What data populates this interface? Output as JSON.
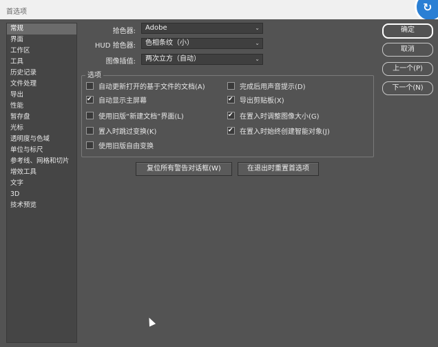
{
  "window": {
    "title": "首选项"
  },
  "sidebar": {
    "items": [
      {
        "label": "常规",
        "selected": true
      },
      {
        "label": "界面"
      },
      {
        "label": "工作区"
      },
      {
        "label": "工具"
      },
      {
        "label": "历史记录"
      },
      {
        "label": "文件处理"
      },
      {
        "label": "导出"
      },
      {
        "label": "性能"
      },
      {
        "label": "暂存盘"
      },
      {
        "label": "光标"
      },
      {
        "label": "透明度与色域"
      },
      {
        "label": "单位与标尺"
      },
      {
        "label": "参考线、网格和切片"
      },
      {
        "label": "增效工具"
      },
      {
        "label": "文字"
      },
      {
        "label": "3D"
      },
      {
        "label": "技术预览"
      }
    ]
  },
  "fields": {
    "color_picker": {
      "label": "拾色器:",
      "value": "Adobe"
    },
    "hud_color_picker": {
      "label": "HUD 拾色器:",
      "value": "色相条纹（小）"
    },
    "image_interpolation": {
      "label": "图像插值:",
      "value": "两次立方（自动）"
    }
  },
  "options": {
    "title": "选项",
    "left": [
      {
        "label": "自动更新打开的基于文件的文档(A)",
        "checked": false
      },
      {
        "label": "自动显示主屏幕",
        "checked": true
      },
      {
        "label": "使用旧版“新建文档”界面(L)",
        "checked": false
      },
      {
        "label": "置入时跳过变换(K)",
        "checked": false
      },
      {
        "label": "使用旧版自由变换",
        "checked": false
      }
    ],
    "right": [
      {
        "label": "完成后用声音提示(D)",
        "checked": false
      },
      {
        "label": "导出剪贴板(X)",
        "checked": true
      },
      {
        "label": "在置入时调整图像大小(G)",
        "checked": true
      },
      {
        "label": "在置入时始终创建智能对象(J)",
        "checked": true
      }
    ]
  },
  "buttons": {
    "reset_warnings": "复位所有警告对话框(W)",
    "reset_on_quit": "在退出时重置首选项",
    "ok": "确定",
    "cancel": "取消",
    "prev": "上一个(P)",
    "next": "下一个(N)"
  }
}
